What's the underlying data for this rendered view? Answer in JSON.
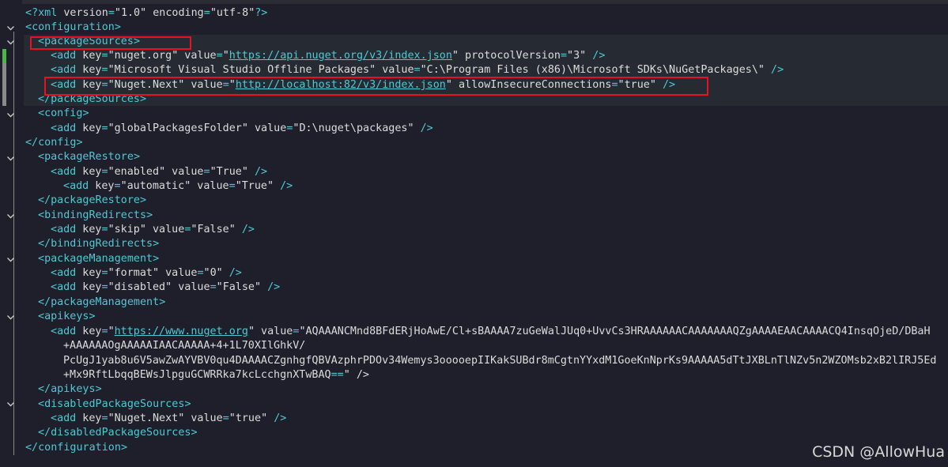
{
  "document": {
    "lines": [
      "<?xml version=\"1.0\" encoding=\"utf-8\"?>",
      "<configuration>",
      "<packageSources>",
      "<add key=\"nuget.org\" value=\"https://api.nuget.org/v3/index.json\" protocolVersion=\"3\" />",
      "<add key=\"Microsoft Visual Studio Offline Packages\" value=\"C:\\Program Files (x86)\\Microsoft SDKs\\NuGetPackages\\\" />",
      "<add key=\"Nuget.Next\" value=\"http://localhost:82/v3/index.json\" allowInsecureConnections=\"true\" />",
      "</packageSources>",
      "<config>",
      "<add key=\"globalPackagesFolder\" value=\"D:\\nuget\\packages\" />",
      "</config>",
      "<packageRestore>",
      "<add key=\"enabled\" value=\"True\" />",
      "<add key=\"automatic\" value=\"True\" />",
      "</packageRestore>",
      "<bindingRedirects>",
      "<add key=\"skip\" value=\"False\" />",
      "</bindingRedirects>",
      "<packageManagement>",
      "<add key=\"format\" value=\"0\" />",
      "<add key=\"disabled\" value=\"False\" />",
      "</packageManagement>",
      "<apikeys>",
      "<add key=\"https://www.nuget.org\" value=\"AQAAANCMnd8BFdERjHoAwE/Cl+sBAAAA7zuGeWalJUq0+UvvCs3HRAAAAAACAAAAAAAQZgAAAAEAACAAAACQ4InsqOjeD/DBaH",
      "+AAAAAAOgAAAAAIAACAAAAA+4+1L70XIlGhkV/",
      "PcUgJ1yab8u6V5awZwAYVBV0qu4DAAAACZgnhgfQBVAzphrPDOv34Wemys3ooooepIIKakSUBdr8mCgtnYYxdM1GoeKnNprKs9AAAAA5dTtJXBLnTlNZv5n2WZOMsb2xB2lIRJ5Ed",
      "+Mx9RftLbqqBEWsJlpguGCWRRka7kcLcchgnXTwBAQ==\" />",
      "</apikeys>",
      "<disabledPackageSources>",
      "<add key=\"Nuget.Next\" value=\"true\" />",
      "</disabledPackageSources>",
      "</configuration>"
    ]
  },
  "watermark": "CSDN @AllowHua",
  "colors": {
    "background": "#1e1f2a",
    "bracket_and_tag": "#4ec9d4",
    "attribute_and_text": "#dcdcdc",
    "highlight_box": "#e81123",
    "change_marker_green": "#4cb748",
    "change_marker_gray": "#8a8a8a"
  },
  "icons": {
    "fold": "chevron-down-icon"
  }
}
